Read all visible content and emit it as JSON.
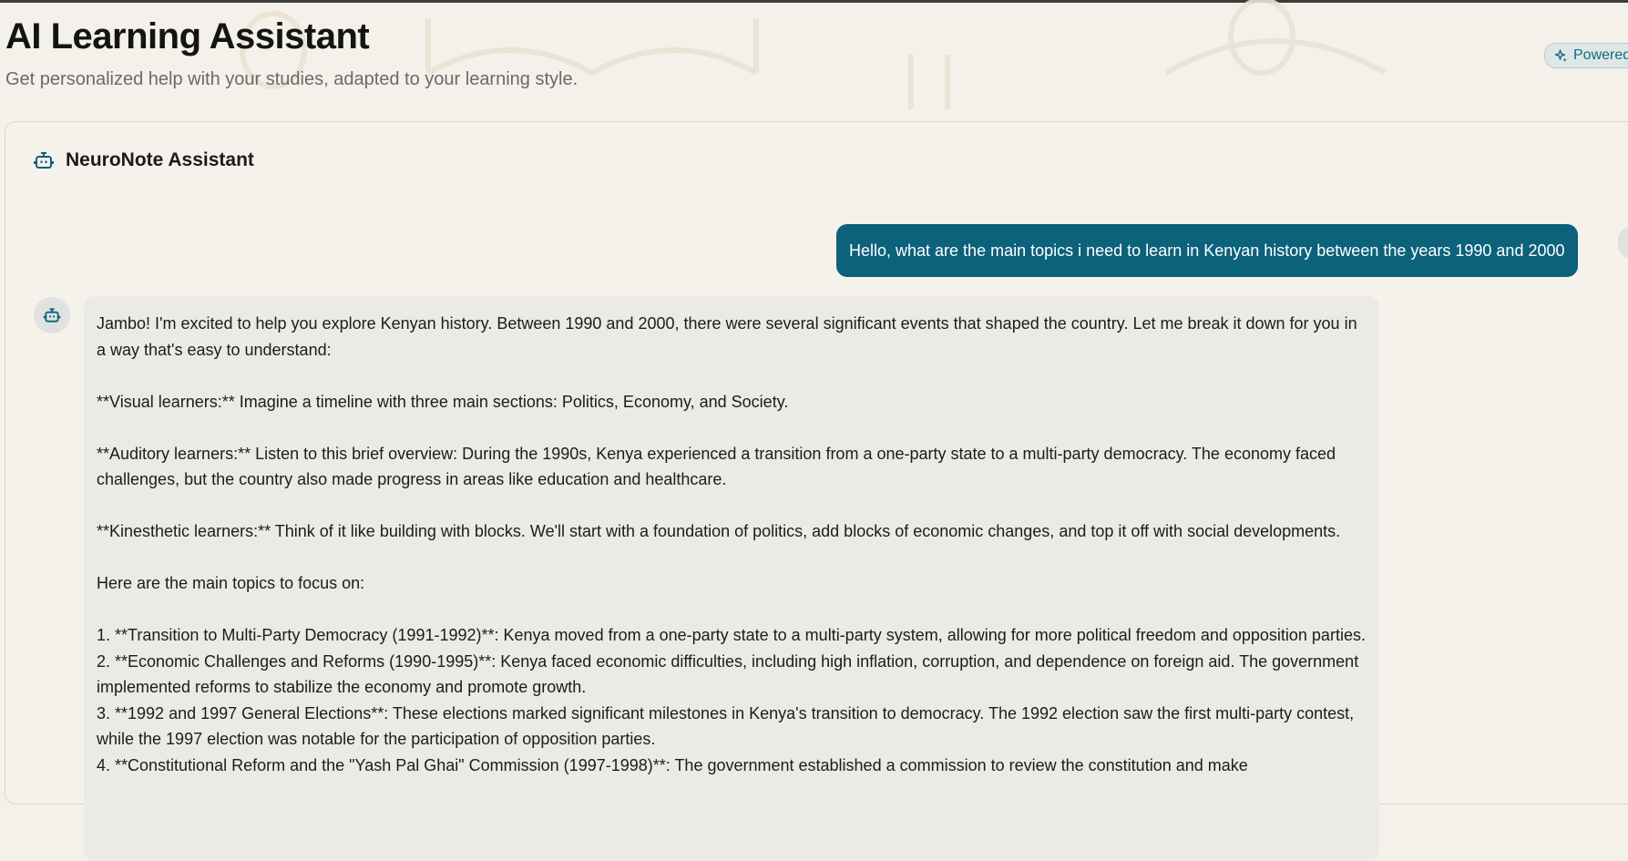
{
  "header": {
    "title": "AI Learning Assistant",
    "subtitle": "Get personalized help with your studies, adapted to your learning style.",
    "badge_label": "Powered"
  },
  "chat": {
    "assistant_name": "NeuroNote Assistant",
    "messages": [
      {
        "role": "user",
        "text": "Hello, what are the main topics i need to learn in Kenyan history between the years 1990 and 2000"
      },
      {
        "role": "assistant",
        "paragraphs": [
          "Jambo! I'm excited to help you explore Kenyan history. Between 1990 and 2000, there were several significant events that shaped the country. Let me break it down for you in a way that's easy to understand:",
          "**Visual learners:** Imagine a timeline with three main sections: Politics, Economy, and Society.",
          "**Auditory learners:** Listen to this brief overview: During the 1990s, Kenya experienced a transition from a one-party state to a multi-party democracy. The economy faced challenges, but the country also made progress in areas like education and healthcare.",
          "**Kinesthetic learners:** Think of it like building with blocks. We'll start with a foundation of politics, add blocks of economic changes, and top it off with social developments.",
          "Here are the main topics to focus on:"
        ],
        "list_items": [
          "1. **Transition to Multi-Party Democracy (1991-1992)**: Kenya moved from a one-party state to a multi-party system, allowing for more political freedom and opposition parties.",
          "2. **Economic Challenges and Reforms (1990-1995)**: Kenya faced economic difficulties, including high inflation, corruption, and dependence on foreign aid. The government implemented reforms to stabilize the economy and promote growth.",
          "3. **1992 and 1997 General Elections**: These elections marked significant milestones in Kenya's transition to democracy. The 1992 election saw the first multi-party contest, while the 1997 election was notable for the participation of opposition parties.",
          "4. **Constitutional Reform and the \"Yash Pal Ghai\" Commission (1997-1998)**: The government established a commission to review the constitution and make"
        ]
      }
    ]
  },
  "icons": {
    "badge": "sparkle-icon",
    "assistant": "robot-icon"
  },
  "colors": {
    "background": "#f4f1ea",
    "user_bubble": "#0c617b",
    "assistant_bubble": "#eceae4",
    "accent": "#0e6a86"
  }
}
